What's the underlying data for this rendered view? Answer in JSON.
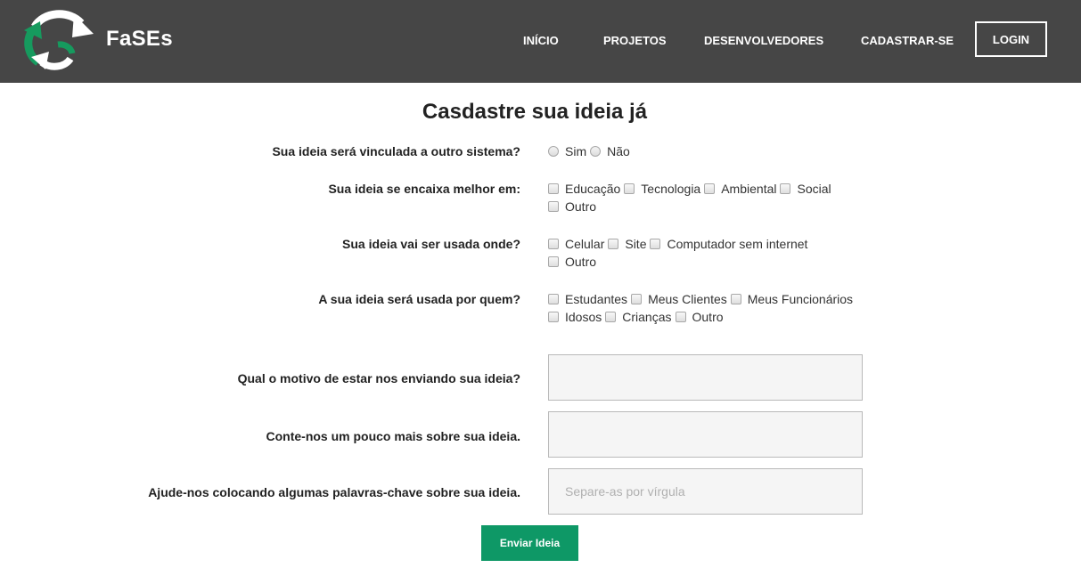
{
  "header": {
    "brand": "FaSEs",
    "nav": [
      "INÍCIO",
      "PROJETOS",
      "DESENVOLVEDORES",
      "CADASTRAR-SE"
    ],
    "login_label": "LOGIN"
  },
  "form": {
    "title": "Casdastre sua ideia já",
    "q1": {
      "label": "Sua ideia será vinculada a outro sistema?",
      "options": [
        "Sim",
        "Não"
      ]
    },
    "q2": {
      "label": "Sua ideia se encaixa melhor em:",
      "options": [
        "Educação",
        "Tecnologia",
        "Ambiental",
        "Social",
        "Outro"
      ]
    },
    "q3": {
      "label": "Sua ideia vai ser usada onde?",
      "options": [
        "Celular",
        "Site",
        "Computador sem internet",
        "Outro"
      ]
    },
    "q4": {
      "label": "A sua ideia será usada por quem?",
      "options": [
        "Estudantes",
        "Meus Clientes",
        "Meus Funcionários",
        "Idosos",
        "Crianças",
        "Outro"
      ]
    },
    "motivo": {
      "label": "Qual o motivo de estar nos enviando sua ideia?",
      "value": ""
    },
    "sobre": {
      "label": "Conte-nos um pouco mais sobre sua ideia.",
      "value": ""
    },
    "keywords": {
      "label": "Ajude-nos colocando algumas palavras-chave sobre sua ideia.",
      "placeholder": "Separe-as por vírgula",
      "value": ""
    },
    "submit_label": "Enviar Ideia"
  },
  "colors": {
    "navbar": "#464646",
    "accent": "#0e9866",
    "logo_green": "#169a5e"
  }
}
